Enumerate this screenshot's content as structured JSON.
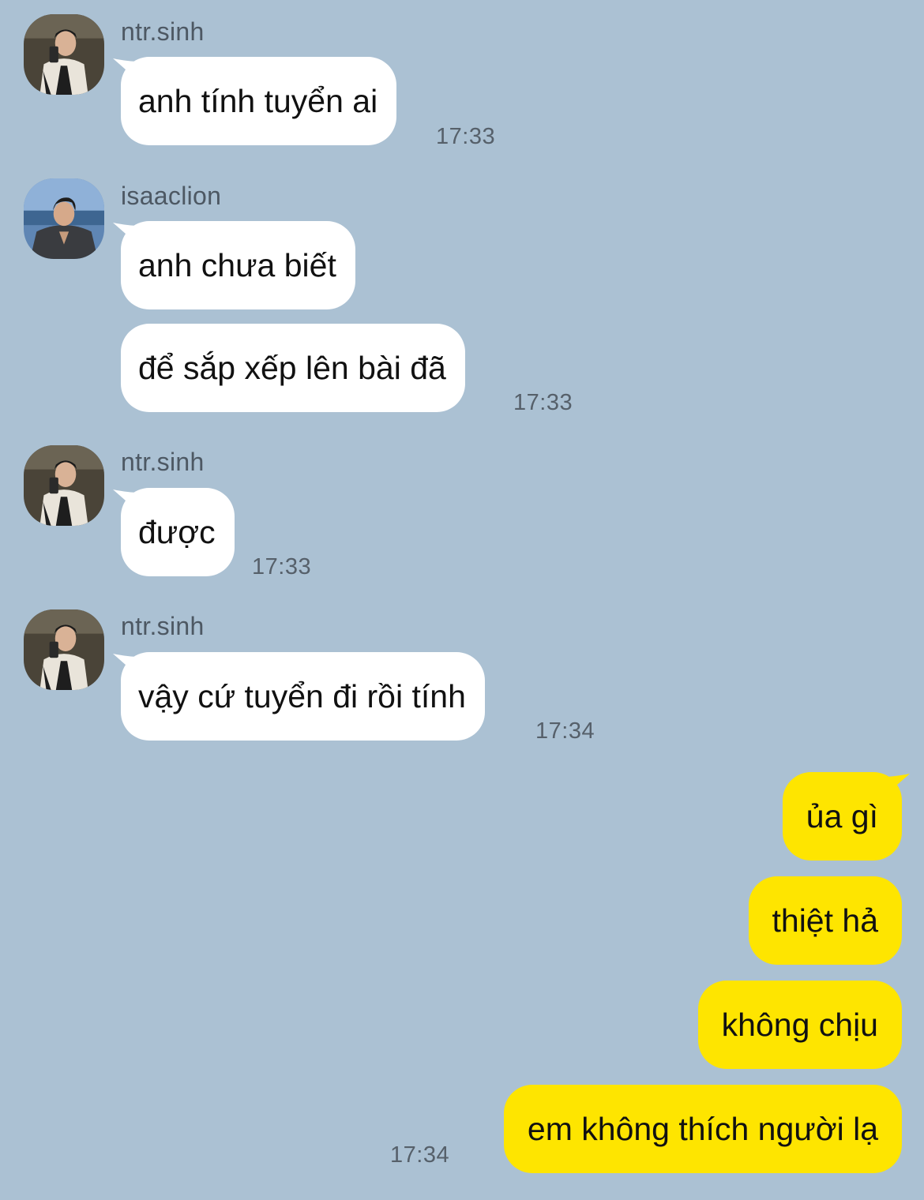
{
  "colors": {
    "background": "#abc1d3",
    "incoming_bubble": "#ffffff",
    "outgoing_bubble": "#fee500",
    "sender_name": "#4d5863",
    "timestamp": "#56606a"
  },
  "groups": [
    {
      "sender": "ntr.sinh",
      "avatar_icon": "profile-photo",
      "messages": [
        "anh tính tuyển ai"
      ],
      "time": "17:33"
    },
    {
      "sender": "isaaclion",
      "avatar_icon": "profile-photo",
      "messages": [
        "anh chưa biết",
        "để sắp xếp lên bài đã"
      ],
      "time": "17:33"
    },
    {
      "sender": "ntr.sinh",
      "avatar_icon": "profile-photo",
      "messages": [
        "được"
      ],
      "time": "17:33"
    },
    {
      "sender": "ntr.sinh",
      "avatar_icon": "profile-photo",
      "messages": [
        "vậy cứ tuyển đi rồi tính"
      ],
      "time": "17:34"
    }
  ],
  "outgoing": {
    "messages": [
      "ủa gì",
      "thiệt hả",
      "không chịu",
      "em không thích người lạ"
    ],
    "time": "17:34"
  }
}
